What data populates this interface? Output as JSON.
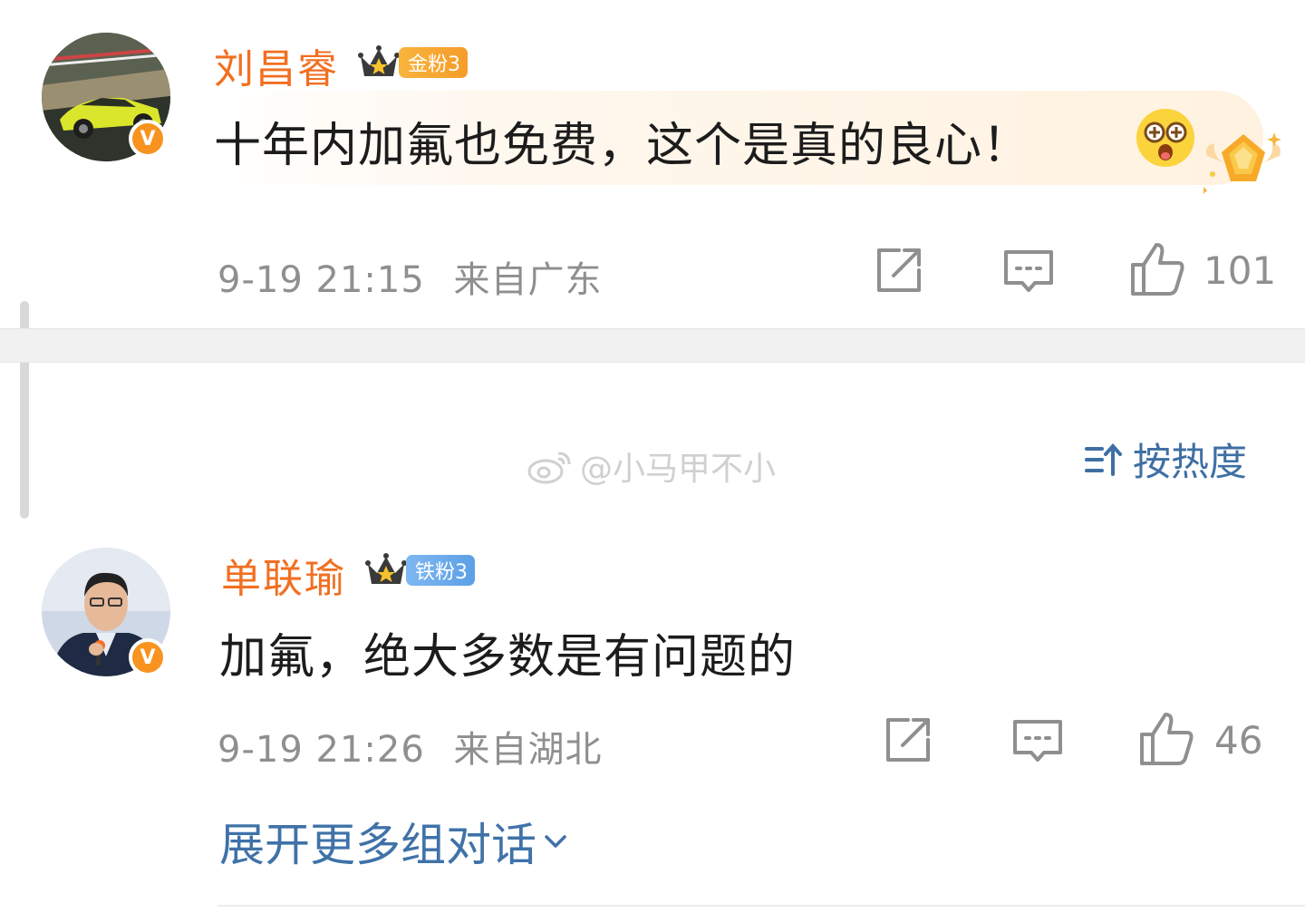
{
  "comments": [
    {
      "username": "刘昌睿",
      "fan_badge": "金粉3",
      "text": "十年内加氟也免费，这个是真的良心！",
      "time": "9-19 21:15",
      "location": "来自广东",
      "likes": "101",
      "verified_badge": "V",
      "icons": [
        "forward-icon",
        "comment-icon",
        "like-icon"
      ]
    },
    {
      "username": "单联瑜",
      "fan_badge": "铁粉3",
      "text": "加氟，绝大多数是有问题的",
      "time": "9-19 21:26",
      "location": "来自湖北",
      "likes": "46",
      "verified_badge": "V",
      "icons": [
        "forward-icon",
        "comment-icon",
        "like-icon"
      ]
    }
  ],
  "sort": {
    "label": "按热度"
  },
  "watermark": {
    "text": "@小马甲不小"
  },
  "expand": {
    "label": "展开更多组对话"
  },
  "colors": {
    "username": "#f26f21",
    "link": "#3f72a8",
    "meta": "#8f8f8f",
    "gold_badge": "#f59c2a",
    "iron_badge": "#5c9fe6"
  }
}
